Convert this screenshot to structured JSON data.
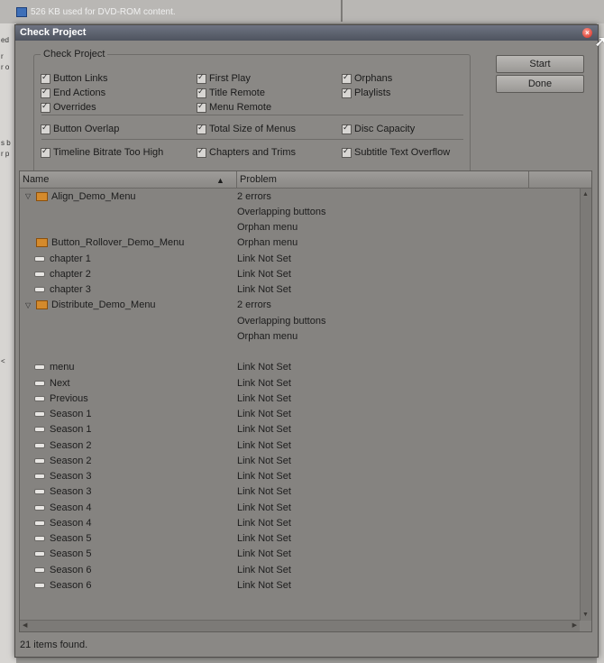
{
  "background": {
    "info_text": "526 KB used for DVD-ROM content.",
    "left_fragments": [
      "ed",
      "r",
      "r o",
      "s b",
      "r p",
      "<"
    ]
  },
  "dialog": {
    "title": "Check Project",
    "group_label": "Check Project",
    "checks": [
      {
        "label": "Button Links",
        "checked": true
      },
      {
        "label": "First Play",
        "checked": true
      },
      {
        "label": "Orphans",
        "checked": true
      },
      {
        "label": "End Actions",
        "checked": true
      },
      {
        "label": "Title Remote",
        "checked": true
      },
      {
        "label": "Playlists",
        "checked": true
      },
      {
        "label": "Overrides",
        "checked": true
      },
      {
        "label": "Menu Remote",
        "checked": true
      },
      {
        "label": "Button Overlap",
        "checked": true
      },
      {
        "label": "Total Size of Menus",
        "checked": true
      },
      {
        "label": "Disc Capacity",
        "checked": true
      },
      {
        "label": "Timeline Bitrate Too High",
        "checked": true
      },
      {
        "label": "Chapters and Trims",
        "checked": true
      },
      {
        "label": "Subtitle Text Overflow",
        "checked": true
      }
    ],
    "start_label": "Start",
    "done_label": "Done"
  },
  "list": {
    "columns": {
      "name": "Name",
      "problem": "Problem"
    },
    "rows": [
      {
        "type": "menu",
        "expanded": true,
        "name": "Align_Demo_Menu",
        "problem": "2 errors"
      },
      {
        "type": "sub",
        "name": "",
        "problem": "Overlapping buttons"
      },
      {
        "type": "sub",
        "name": "",
        "problem": "Orphan menu"
      },
      {
        "type": "menu",
        "expanded": false,
        "name": "Button_Rollover_Demo_Menu",
        "problem": "Orphan menu"
      },
      {
        "type": "button",
        "name": "chapter 1",
        "problem": "Link Not Set"
      },
      {
        "type": "button",
        "name": "chapter 2",
        "problem": "Link Not Set"
      },
      {
        "type": "button",
        "name": "chapter 3",
        "problem": "Link Not Set"
      },
      {
        "type": "menu",
        "expanded": true,
        "name": "Distribute_Demo_Menu",
        "problem": "2 errors"
      },
      {
        "type": "sub",
        "name": "",
        "problem": "Overlapping buttons"
      },
      {
        "type": "sub",
        "name": "",
        "problem": "Orphan menu"
      },
      {
        "type": "blank",
        "name": "",
        "problem": ""
      },
      {
        "type": "button",
        "name": "menu",
        "problem": "Link Not Set"
      },
      {
        "type": "button",
        "name": "Next",
        "problem": "Link Not Set"
      },
      {
        "type": "button",
        "name": "Previous",
        "problem": "Link Not Set"
      },
      {
        "type": "button",
        "name": "Season 1",
        "problem": "Link Not Set"
      },
      {
        "type": "button",
        "name": "Season 1",
        "problem": "Link Not Set"
      },
      {
        "type": "button",
        "name": "Season 2",
        "problem": "Link Not Set"
      },
      {
        "type": "button",
        "name": "Season 2",
        "problem": "Link Not Set"
      },
      {
        "type": "button",
        "name": "Season 3",
        "problem": "Link Not Set"
      },
      {
        "type": "button",
        "name": "Season 3",
        "problem": "Link Not Set"
      },
      {
        "type": "button",
        "name": "Season 4",
        "problem": "Link Not Set"
      },
      {
        "type": "button",
        "name": "Season 4",
        "problem": "Link Not Set"
      },
      {
        "type": "button",
        "name": "Season 5",
        "problem": "Link Not Set"
      },
      {
        "type": "button",
        "name": "Season 5",
        "problem": "Link Not Set"
      },
      {
        "type": "button",
        "name": "Season 6",
        "problem": "Link Not Set"
      },
      {
        "type": "button",
        "name": "Season 6",
        "problem": "Link Not Set"
      }
    ]
  },
  "status": "21 items found."
}
